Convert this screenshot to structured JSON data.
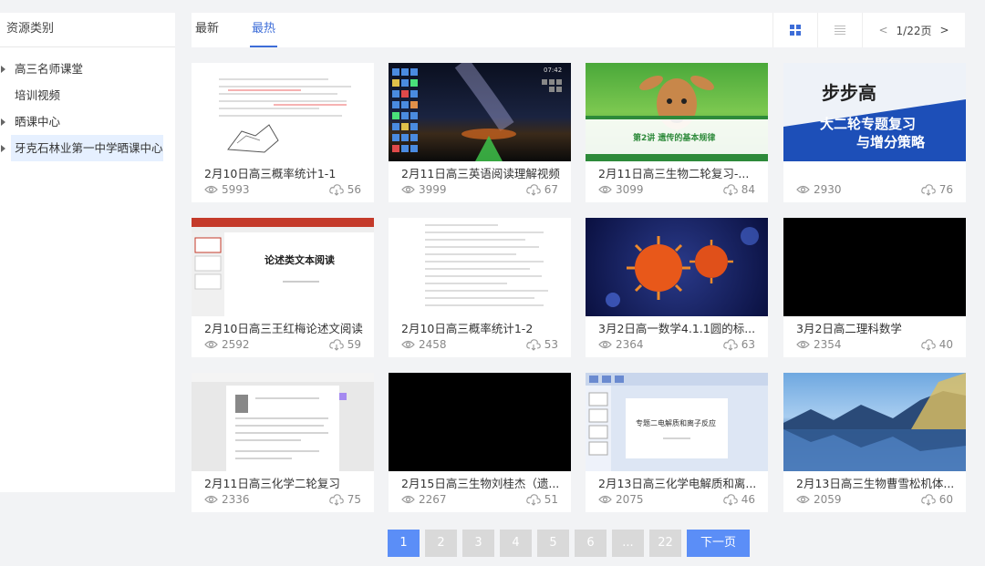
{
  "sidebar": {
    "title": "资源类别",
    "items": [
      {
        "label": "高三名师课堂",
        "expandable": true
      },
      {
        "label": "培训视频",
        "expandable": false
      },
      {
        "label": "晒课中心",
        "expandable": true
      },
      {
        "label": "牙克石林业第一中学晒课中心",
        "expandable": true,
        "selected": true
      }
    ]
  },
  "tabs": [
    {
      "label": "最新",
      "active": false
    },
    {
      "label": "最热",
      "active": true
    }
  ],
  "view_modes": {
    "grid_icon": "grid-view-icon",
    "list_icon": "list-view-icon"
  },
  "mini_pager": {
    "prev": "<",
    "page": "1/22页",
    "next": ">"
  },
  "cards": [
    {
      "title": "2月10日高三概率统计1-1",
      "views": "5993",
      "downloads": "56"
    },
    {
      "title": "2月11日高三英语阅读理解视频",
      "views": "3999",
      "downloads": "67"
    },
    {
      "title": "2月11日高三生物二轮复习-...",
      "views": "3099",
      "downloads": "84"
    },
    {
      "title": "",
      "views": "2930",
      "downloads": "76"
    },
    {
      "title": "2月10日高三王红梅论述文阅读",
      "views": "2592",
      "downloads": "59"
    },
    {
      "title": "2月10日高三概率统计1-2",
      "views": "2458",
      "downloads": "53"
    },
    {
      "title": "3月2日高一数学4.1.1圆的标...",
      "views": "2364",
      "downloads": "63"
    },
    {
      "title": "3月2日高二理科数学",
      "views": "2354",
      "downloads": "40"
    },
    {
      "title": "2月11日高三化学二轮复习",
      "views": "2336",
      "downloads": "75"
    },
    {
      "title": "2月15日高三生物刘桂杰（遗...",
      "views": "2267",
      "downloads": "51"
    },
    {
      "title": "2月13日高三化学电解质和离...",
      "views": "2075",
      "downloads": "46"
    },
    {
      "title": "2月13日高三生物曹雪松机体...",
      "views": "2059",
      "downloads": "60"
    }
  ],
  "thumb_text": {
    "bio_lesson": "第2讲  遗传的基本规律",
    "book_line1": "大二轮专题复习",
    "book_line2": "与增分策略",
    "book_brand": "步步高",
    "ppt_title": "论述类文本阅读",
    "ppt2_title": "专题二电解质和离子反应",
    "clock": "07:42"
  },
  "pagination": {
    "pages": [
      "1",
      "2",
      "3",
      "4",
      "5",
      "6",
      "...",
      "22"
    ],
    "active": "1",
    "next_label": "下一页"
  },
  "colors": {
    "accent": "#3d6dd8",
    "page_active": "#5b8ef7",
    "page_idle": "#d9d9d9"
  }
}
